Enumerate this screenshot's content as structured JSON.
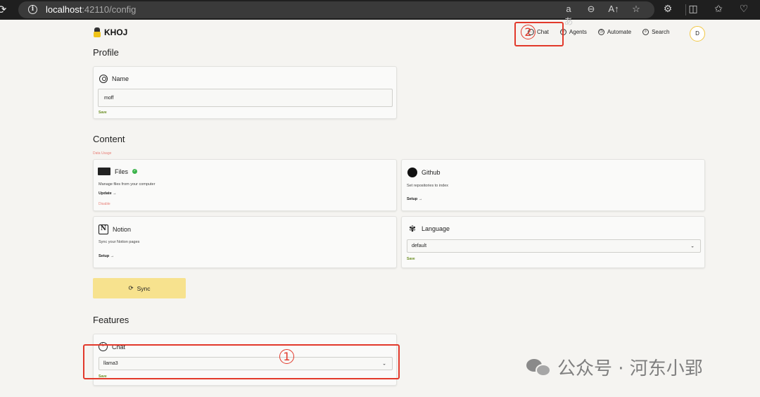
{
  "browser": {
    "url_host": "localhost",
    "url_path": ":42110/config",
    "reload_glyph": "⟳",
    "info_glyph": "i",
    "url_icons": [
      "aあ",
      "⊖",
      "A↑",
      "☆"
    ],
    "right_icons": [
      "⚙",
      "◫",
      "✩",
      "♡"
    ]
  },
  "header": {
    "logo_text": "KHOJ",
    "nav": [
      {
        "label": "Chat",
        "icon": "chat-icon",
        "glyph": "…"
      },
      {
        "label": "Agents",
        "icon": "agents-icon",
        "glyph": "☺"
      },
      {
        "label": "Automate",
        "icon": "automate-icon",
        "glyph": "◷"
      },
      {
        "label": "Search",
        "icon": "search-icon",
        "glyph": "⌕"
      }
    ],
    "avatar_initial": "D"
  },
  "annotations": {
    "one": "1",
    "two": "2"
  },
  "profile": {
    "heading": "Profile",
    "name_title": "Name",
    "name_value": "moff",
    "save_label": "Save"
  },
  "content": {
    "heading": "Content",
    "data_usage_label": "Data Usage",
    "files": {
      "title": "Files",
      "desc": "Manage files from your computer",
      "action": "Update →",
      "disable": "Disable",
      "check": "✓"
    },
    "github": {
      "title": "Github",
      "desc": "Set repositories to index",
      "action": "Setup →"
    },
    "notion": {
      "title": "Notion",
      "desc": "Sync your Notion pages",
      "action": "Setup →",
      "glyph": "N"
    },
    "language": {
      "title": "Language",
      "value": "default",
      "save": "Save",
      "glyph": "✾"
    },
    "sync_label": "Sync",
    "sync_glyph": "⟳",
    "chevron": "⌄"
  },
  "features": {
    "heading": "Features",
    "chat_title": "Chat",
    "chat_glyph": "ᴸ",
    "chat_model": "llama3",
    "save_label": "Save"
  },
  "watermark": {
    "text": "公众号 · 河东小郢"
  },
  "colors": {
    "accent_yellow": "#f7e28e",
    "annotation_red": "#e2392b",
    "save_green": "#6b8e23",
    "status_green": "#3bb34a"
  }
}
